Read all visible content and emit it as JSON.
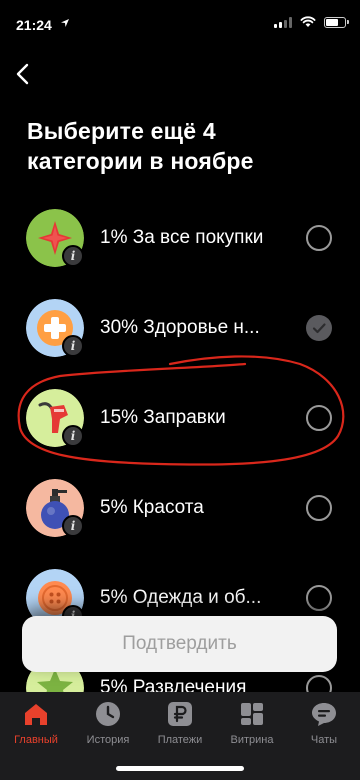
{
  "status": {
    "time": "21:24"
  },
  "title": "Выберите ещё 4 категории в ноябре",
  "categories": [
    {
      "label": "1% За все покупки",
      "selected": false,
      "icon": "star-icon",
      "icon_bg": "#8bc34a"
    },
    {
      "label": "30% Здоровье н...",
      "selected": true,
      "icon": "medical-cross-icon",
      "icon_bg": "#b3d4f5"
    },
    {
      "label": "15% Заправки",
      "selected": false,
      "icon": "fuel-nozzle-icon",
      "icon_bg": "#d6ee9c"
    },
    {
      "label": "5% Красота",
      "selected": false,
      "icon": "perfume-bottle-icon",
      "icon_bg": "#f5b8a0"
    },
    {
      "label": "5% Одежда и об...",
      "selected": false,
      "icon": "button-icon",
      "icon_bg": "#b3d4f5"
    },
    {
      "label": "5% Развлечения",
      "selected": false,
      "icon": "green-star-icon",
      "icon_bg": "#d6ee9c"
    }
  ],
  "confirm_label": "Подтвердить",
  "tabs": [
    {
      "label": "Главный",
      "icon": "home-icon",
      "active": true
    },
    {
      "label": "История",
      "icon": "clock-icon",
      "active": false
    },
    {
      "label": "Платежи",
      "icon": "ruble-icon",
      "active": false
    },
    {
      "label": "Витрина",
      "icon": "grid-icon",
      "active": false
    },
    {
      "label": "Чаты",
      "icon": "chat-icon",
      "active": false
    }
  ],
  "colors": {
    "accent": "#e8412c",
    "annotation": "#d9271b"
  }
}
